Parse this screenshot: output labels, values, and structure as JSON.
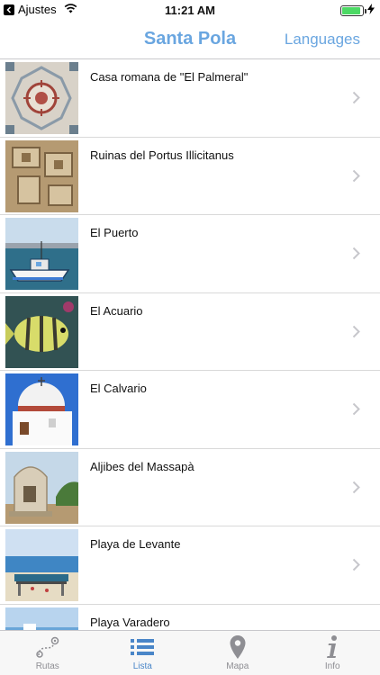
{
  "status_bar": {
    "back_label": "Ajustes",
    "time": "11:21 AM",
    "battery_level": 0.9
  },
  "nav": {
    "title": "Santa Pola",
    "right_button": "Languages"
  },
  "list": {
    "items": [
      {
        "label": "Casa romana de \"El Palmeral\"",
        "thumb": "mosaic"
      },
      {
        "label": "Ruinas del Portus Illicitanus",
        "thumb": "ruins"
      },
      {
        "label": "El Puerto",
        "thumb": "port"
      },
      {
        "label": "El Acuario",
        "thumb": "fish"
      },
      {
        "label": "El Calvario",
        "thumb": "chapel"
      },
      {
        "label": "Aljibes del Massapà",
        "thumb": "cistern"
      },
      {
        "label": "Playa de Levante",
        "thumb": "beach"
      },
      {
        "label": "Playa Varadero",
        "thumb": "beach2"
      }
    ]
  },
  "tabs": [
    {
      "label": "Rutas",
      "icon": "route-icon",
      "active": false
    },
    {
      "label": "Lista",
      "icon": "list-icon",
      "active": true
    },
    {
      "label": "Mapa",
      "icon": "map-pin-icon",
      "active": false
    },
    {
      "label": "Info",
      "icon": "info-icon",
      "active": false
    }
  ],
  "colors": {
    "accent": "#6aa6e0",
    "tab_active": "#4a86c8",
    "tab_inactive": "#8e8e93",
    "battery": "#4cd964"
  }
}
